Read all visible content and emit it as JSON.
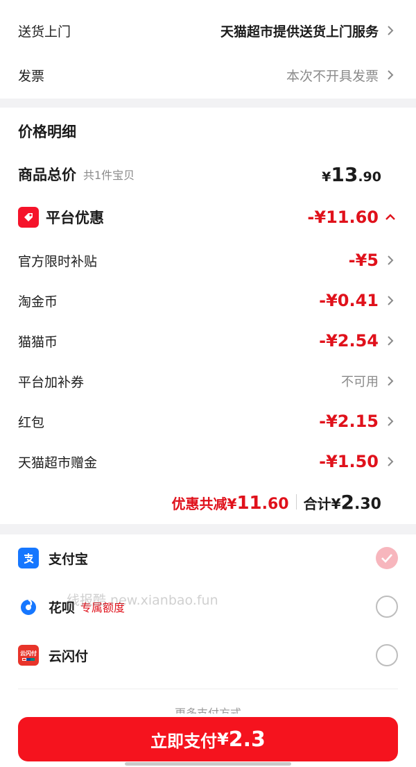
{
  "delivery": {
    "label": "送货上门",
    "value": "天猫超市提供送货上门服务"
  },
  "invoice": {
    "label": "发票",
    "value": "本次不开具发票"
  },
  "price_detail": {
    "title": "价格明细",
    "subtotal": {
      "label": "商品总价",
      "note": "共1件宝贝",
      "yen": "¥",
      "int": "13",
      "dec": ".90"
    },
    "platform_discount": {
      "label": "平台优惠",
      "value": "-¥11.60"
    },
    "items": [
      {
        "label": "官方限时补贴",
        "value": "-¥5"
      },
      {
        "label": "淘金币",
        "value": "-¥0.41"
      },
      {
        "label": "猫猫币",
        "value": "-¥2.54"
      },
      {
        "label": "平台加补券",
        "value": "不可用"
      },
      {
        "label": "红包",
        "value": "-¥2.15"
      },
      {
        "label": "天猫超市赠金",
        "value": "-¥1.50"
      }
    ],
    "summary": {
      "discount_label": "优惠共减",
      "discount_yen": "¥",
      "discount_int": "11",
      "discount_dec": ".60",
      "total_label": "合计",
      "total_yen": "¥",
      "total_int": "2",
      "total_dec": ".30"
    }
  },
  "payment": {
    "methods": [
      {
        "name": "支付宝",
        "tag": "",
        "icon": "alipay-icon",
        "checked": true
      },
      {
        "name": "花呗",
        "tag": "专属额度",
        "icon": "huabei-icon",
        "checked": false
      },
      {
        "name": "云闪付",
        "tag": "",
        "icon": "unionpay-icon",
        "checked": false
      }
    ],
    "more": "更多支付方式"
  },
  "watermark": "线报酷 new.xianbao.fun",
  "pay_button": {
    "label": "立即支付",
    "yen": "¥",
    "amount": "2.3"
  },
  "colors": {
    "accent": "#f5131e",
    "discount_red": "#e0111b",
    "alipay_blue": "#1677ff"
  }
}
